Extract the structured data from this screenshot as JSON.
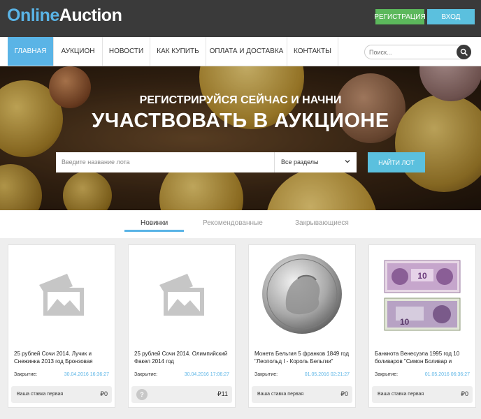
{
  "header": {
    "logo_part1": "Online",
    "logo_part2": "Auction",
    "register_label": "РЕГИСТРАЦИЯ",
    "login_label": "ВХОД"
  },
  "nav": {
    "items": [
      {
        "label": "ГЛАВНАЯ"
      },
      {
        "label": "АУКЦИОН"
      },
      {
        "label": "НОВОСТИ"
      },
      {
        "label": "КАК КУПИТЬ"
      },
      {
        "label": "ОПЛАТА И ДОСТАВКА"
      },
      {
        "label": "КОНТАКТЫ"
      }
    ],
    "search_placeholder": "Поиск..."
  },
  "hero": {
    "subtitle": "РЕГИСТРИРУЙСЯ СЕЙЧАС И НАЧНИ",
    "title": "УЧАСТВОВАТЬ В АУКЦИОНЕ",
    "lot_placeholder": "Введите название лота",
    "sections_value": "Все разделы",
    "find_label": "НАЙТИ ЛОТ"
  },
  "tabs": [
    {
      "label": "Новинки"
    },
    {
      "label": "Рекомендованные"
    },
    {
      "label": "Закрывающиеся"
    }
  ],
  "lots": [
    {
      "title": "25 рублей Сочи 2014. Лучик и Снежинка 2013 год Бронзовая",
      "close_label": "Закрытие:",
      "close_date": "30.04.2016 16:36:27",
      "bid_label": "Ваша ставка первая",
      "bid_value": "₽0"
    },
    {
      "title": "25 рублей Сочи 2014. Олимпийский Факел 2014 год",
      "close_label": "Закрытие:",
      "close_date": "30.04.2016 17:06:27",
      "bid_question": "?",
      "bid_value": "₽11"
    },
    {
      "title": "Монета Бельгия 5 франков 1849 год \"Леопольд I - Король Бельгии\"",
      "close_label": "Закрытие:",
      "close_date": "01.05.2016 02:21:27",
      "bid_label": "Ваша ставка первая",
      "bid_value": "₽0"
    },
    {
      "title": "Банкнота Венесуэла 1995 год 10 боливаров \"Симон Боливар и",
      "close_label": "Закрытие:",
      "close_date": "01.05.2016 06:36:27",
      "bid_label": "Ваша ставка первая",
      "bid_value": "₽0"
    }
  ],
  "colors": {
    "accent": "#5ab4e6",
    "register": "#5cb85c",
    "login": "#5bc0de",
    "topbar": "#3a3a3a"
  }
}
